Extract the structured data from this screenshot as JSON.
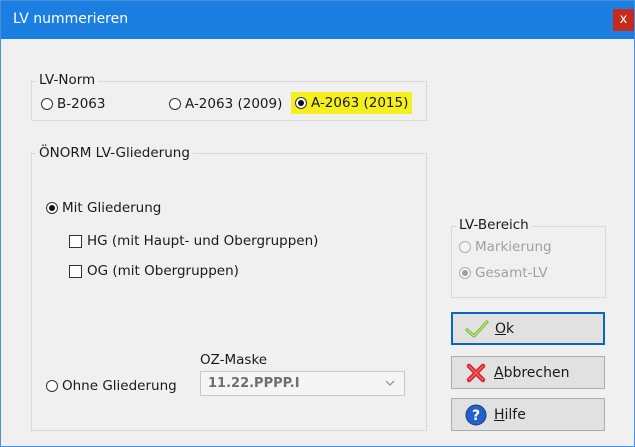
{
  "window": {
    "title": "LV nummerieren",
    "close_glyph": "x"
  },
  "lv_norm": {
    "legend": "LV-Norm",
    "options": [
      {
        "label": "B-2063",
        "selected": false
      },
      {
        "label": "A-2063 (2009)",
        "selected": false
      },
      {
        "label": "A-2063 (2015)",
        "selected": true,
        "highlight": "#f5ef1e"
      }
    ]
  },
  "gliederung": {
    "legend": "ÖNORM LV-Gliederung",
    "mit": {
      "label": "Mit Gliederung",
      "selected": true
    },
    "hg": {
      "label": "HG (mit Haupt- und Obergruppen)",
      "checked": false
    },
    "og": {
      "label": "OG (mit Obergruppen)",
      "checked": false
    },
    "ohne": {
      "label": "Ohne Gliederung",
      "selected": false
    },
    "oz_mask": {
      "label": "OZ-Maske",
      "value": "11.22.PPPP.I",
      "disabled": true
    }
  },
  "lv_bereich": {
    "legend": "LV-Bereich",
    "options": [
      {
        "label": "Markierung",
        "selected": false,
        "disabled": true
      },
      {
        "label": "Gesamt-LV",
        "selected": true,
        "disabled": true
      }
    ]
  },
  "buttons": {
    "ok": {
      "label": "Ok",
      "icon": "checkmark-icon",
      "default": true
    },
    "cancel": {
      "label": "Abbrechen",
      "icon": "red-x-icon"
    },
    "help": {
      "label": "Hilfe",
      "icon": "help-icon"
    }
  },
  "colors": {
    "titlebar": "#1a7fe0",
    "close": "#c42b1c",
    "highlight": "#f5ef1e",
    "default_border": "#0a64c8"
  }
}
